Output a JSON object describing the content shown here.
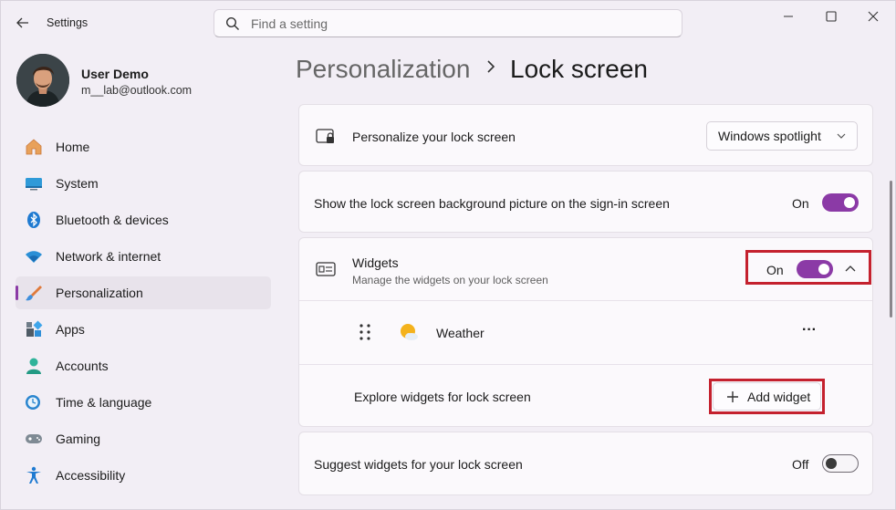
{
  "app": {
    "title": "Settings"
  },
  "search": {
    "placeholder": "Find a setting"
  },
  "user": {
    "name": "User Demo",
    "email": "m__lab@outlook.com"
  },
  "sidebar": {
    "items": [
      {
        "label": "Home",
        "icon": "home-icon"
      },
      {
        "label": "System",
        "icon": "system-icon"
      },
      {
        "label": "Bluetooth & devices",
        "icon": "bluetooth-icon"
      },
      {
        "label": "Network & internet",
        "icon": "network-icon"
      },
      {
        "label": "Personalization",
        "icon": "brush-icon",
        "active": true
      },
      {
        "label": "Apps",
        "icon": "apps-icon"
      },
      {
        "label": "Accounts",
        "icon": "accounts-icon"
      },
      {
        "label": "Time & language",
        "icon": "time-language-icon"
      },
      {
        "label": "Gaming",
        "icon": "gaming-icon"
      },
      {
        "label": "Accessibility",
        "icon": "accessibility-icon"
      }
    ]
  },
  "breadcrumb": {
    "parent": "Personalization",
    "current": "Lock screen"
  },
  "settings": {
    "personalize": {
      "label": "Personalize your lock screen",
      "value": "Windows spotlight"
    },
    "background_on_signin": {
      "label": "Show the lock screen background picture on the sign-in screen",
      "state": "On"
    },
    "widgets": {
      "label": "Widgets",
      "description": "Manage the widgets on your lock screen",
      "state": "On",
      "items": [
        {
          "label": "Weather",
          "more": "···"
        }
      ],
      "explore_label": "Explore widgets for lock screen",
      "add_button": "Add widget"
    },
    "suggest_widgets": {
      "label": "Suggest widgets for your lock screen",
      "state": "Off"
    }
  },
  "colors": {
    "accent": "#8b3aa6",
    "highlight": "#c4212e"
  }
}
